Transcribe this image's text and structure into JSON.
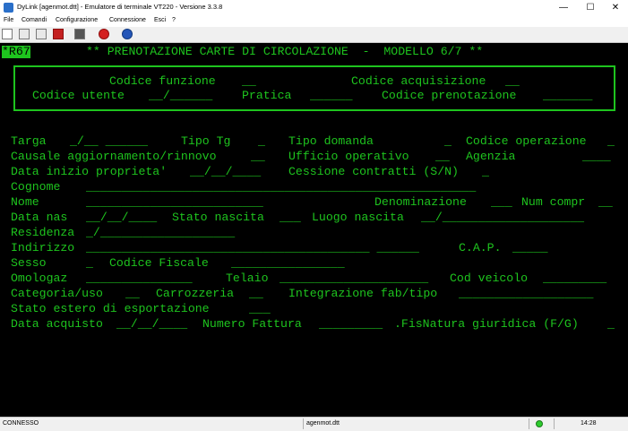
{
  "window": {
    "title": "DyLink [agenmot.dtt] - Emulatore di terminale VT220 - Versione 3.3.8",
    "minimize": "—",
    "maximize": "☐",
    "close": "✕"
  },
  "menu": [
    "File",
    "Comandi",
    "Configurazione",
    "Connessione",
    "Esci",
    "?"
  ],
  "toolbar_icons": [
    "open-icon",
    "folder-icon",
    "connect-icon",
    "stop-icon",
    "print-icon",
    "exit-icon",
    "help-icon"
  ],
  "terminal": {
    "indicator": "*R67",
    "title": "** PRENOTAZIONE CARTE DI CIRCOLAZIONE  -  MODELLO 6/7 **",
    "box": {
      "codice_funzione": "Codice funzione",
      "codice_acquisizione": "Codice acquisizione",
      "codice_utente": "Codice utente",
      "pratica": "Pratica",
      "codice_prenotazione": "Codice prenotazione"
    },
    "labels": {
      "targa": "Targa",
      "tipo_tg": "Tipo Tg",
      "tipo_domanda": "Tipo domanda",
      "codice_operazione": "Codice operazione",
      "causale": "Causale aggiornamento/rinnovo",
      "ufficio": "Ufficio operativo",
      "agenzia": "Agenzia",
      "data_inizio": "Data inizio proprieta'",
      "cessione": "Cessione contratti (S/N)",
      "cognome": "Cognome",
      "nome": "Nome",
      "denominazione": "Denominazione",
      "num_compr": "Num compr",
      "data_nas": "Data nas",
      "stato_nascita": "Stato nascita",
      "luogo_nascita": "Luogo nascita",
      "residenza": "Residenza",
      "indirizzo": "Indirizzo",
      "cap": "C.A.P.",
      "sesso": "Sesso",
      "codice_fiscale": "Codice Fiscale",
      "omologaz": "Omologaz",
      "telaio": "Telaio",
      "cod_veicolo": "Cod veicolo",
      "categoria": "Categoria/uso",
      "carrozzeria": "Carrozzeria",
      "integrazione": "Integrazione fab/tipo",
      "stato_estero": "Stato estero di esportazione",
      "data_acquisto": "Data acquisto",
      "numero_fattura": "Numero Fattura",
      "fisnatura": ".FisNatura giuridica (F/G)"
    },
    "separators": {
      "slash": "/",
      "date": "/  /"
    }
  },
  "status": {
    "connection": "CONNESSO",
    "file": "agenmot.dtt",
    "time": "14:28"
  },
  "colors": {
    "terminal_bg": "#000000",
    "terminal_fg": "#1ec41e"
  }
}
